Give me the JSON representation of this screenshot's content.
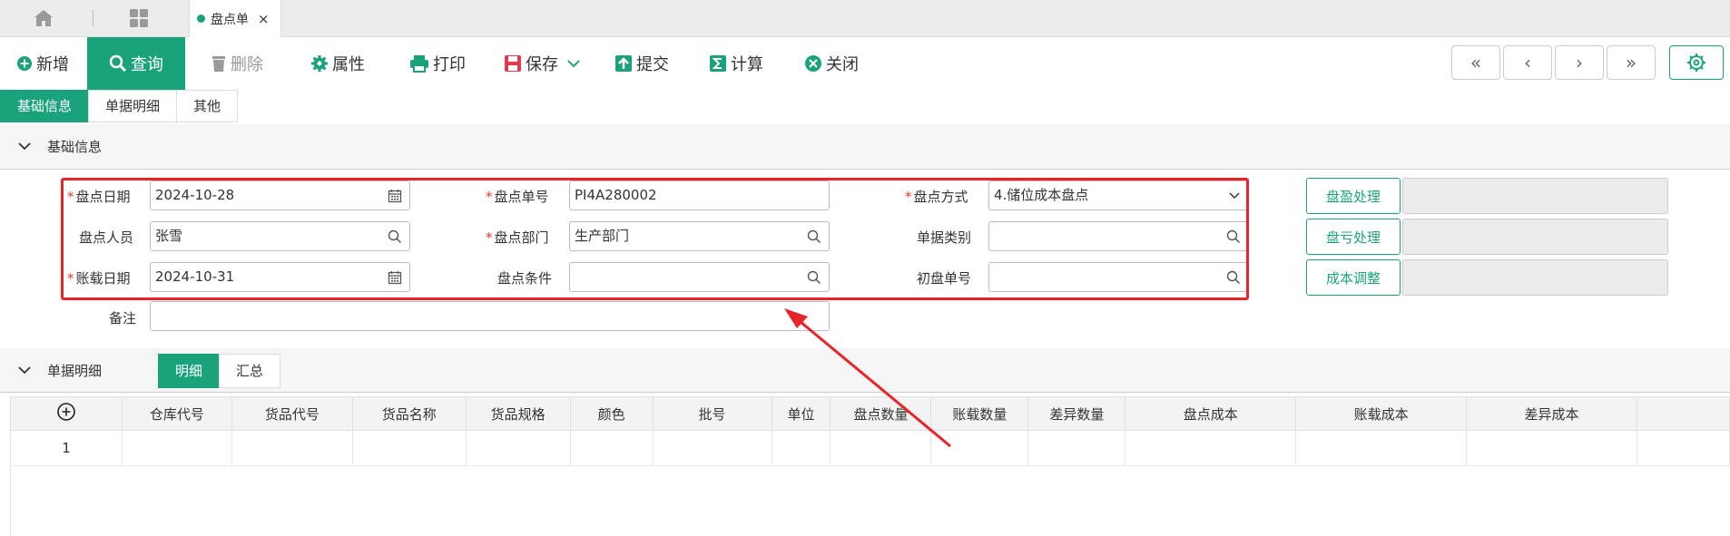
{
  "tabstrip": {
    "home_icon": "home-icon",
    "apps_icon": "grid-icon",
    "doc_tab": {
      "label": "盘点单",
      "close": "×"
    }
  },
  "toolbar": {
    "new": "新增",
    "query": "查询",
    "delete": "删除",
    "properties": "属性",
    "print": "打印",
    "save": "保存",
    "submit": "提交",
    "calculate": "计算",
    "close": "关闭",
    "nav": [
      "«",
      "‹",
      "›",
      "»"
    ]
  },
  "subtabs": [
    "基础信息",
    "单据明细",
    "其他"
  ],
  "basic_section": {
    "title": "基础信息"
  },
  "form": {
    "count_date": {
      "label": "盘点日期",
      "value": "2024-10-28"
    },
    "count_no": {
      "label": "盘点单号",
      "value": "PI4A280002"
    },
    "count_method": {
      "label": "盘点方式",
      "value": "4.储位成本盘点"
    },
    "counter": {
      "label": "盘点人员",
      "value": "张雪"
    },
    "count_dept": {
      "label": "盘点部门",
      "value": "生产部门"
    },
    "doc_type": {
      "label": "单据类别",
      "value": ""
    },
    "book_date": {
      "label": "账载日期",
      "value": "2024-10-31"
    },
    "count_condition": {
      "label": "盘点条件",
      "value": ""
    },
    "initial_no": {
      "label": "初盘单号",
      "value": ""
    },
    "remark": {
      "label": "备注",
      "value": ""
    }
  },
  "side_actions": [
    "盘盈处理",
    "盘亏处理",
    "成本调整"
  ],
  "detail_section": {
    "title": "单据明细",
    "views": [
      "明细",
      "汇总"
    ]
  },
  "grid": {
    "columns": [
      "仓库代号",
      "货品代号",
      "货品名称",
      "货品规格",
      "颜色",
      "批号",
      "单位",
      "盘点数量",
      "账载数量",
      "差异数量",
      "盘点成本",
      "账载成本",
      "差异成本"
    ],
    "rows": [
      [
        "1"
      ]
    ]
  },
  "colors": {
    "accent": "#1aa37a",
    "highlight": "#e8242a"
  }
}
